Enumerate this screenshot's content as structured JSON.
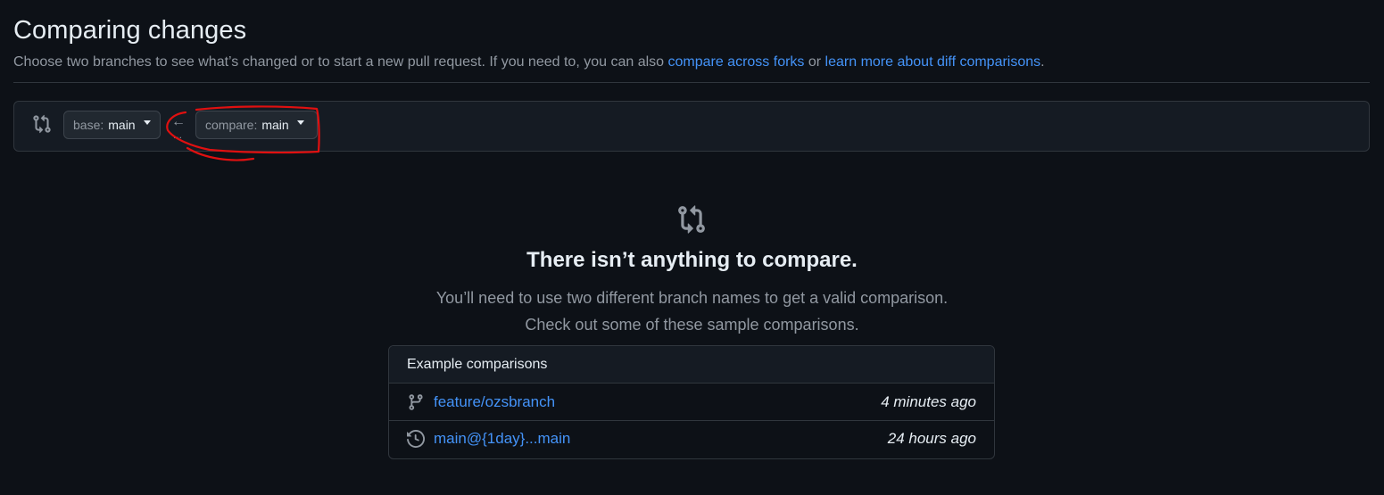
{
  "header": {
    "title": "Comparing changes",
    "subtitle_text": "Choose two branches to see what’s changed or to start a new pull request. If you need to, you can also ",
    "compare_forks_link": "compare across forks",
    "or_text": " or ",
    "learn_more_link": "learn more about diff comparisons",
    "end_text": "."
  },
  "range": {
    "base_prefix": "base:",
    "base_value": "main",
    "compare_prefix": "compare:",
    "compare_value": "main",
    "arrow": "←",
    "dots": "..."
  },
  "blankslate": {
    "icon": "git-compare-icon",
    "title": "There isn’t anything to compare.",
    "line1": "You’ll need to use two different branch names to get a valid comparison.",
    "line2": "Check out some of these sample comparisons."
  },
  "examples": {
    "header": "Example comparisons",
    "rows": [
      {
        "icon": "git-branch-icon",
        "label": "feature/ozsbranch",
        "time": "4 minutes ago"
      },
      {
        "icon": "history-icon",
        "label": "main@{1day}...main",
        "time": "24 hours ago"
      }
    ]
  },
  "colors": {
    "background": "#0d1117",
    "link": "#4493f8",
    "annotation": "#e01010"
  }
}
